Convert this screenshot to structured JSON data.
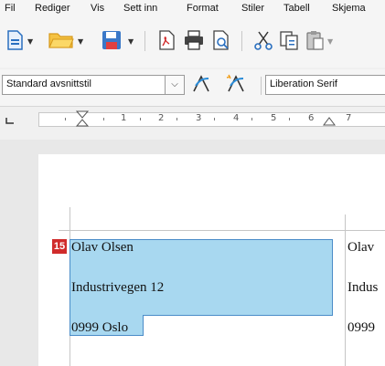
{
  "menu": [
    "Fil",
    "Rediger",
    "Vis",
    "Sett inn",
    "Format",
    "Stiler",
    "Tabell",
    "Skjema"
  ],
  "toolbar": {
    "icons": [
      "new-document-icon",
      "open-folder-icon",
      "save-icon",
      "export-pdf-icon",
      "print-icon",
      "print-preview-icon",
      "cut-icon",
      "copy-icon",
      "paste-icon"
    ]
  },
  "format": {
    "paragraph_style": "Standard avsnittstil",
    "font_name": "Liberation Serif"
  },
  "ruler": {
    "numbers": [
      "1",
      "2",
      "3",
      "4",
      "5",
      "6",
      "7"
    ]
  },
  "document": {
    "field_badge": "15",
    "label1": {
      "name": "Olav Olsen",
      "street": "Industrivegen 12",
      "city": "0999 Oslo"
    },
    "label2": {
      "name": "Olav",
      "street": "Indus",
      "city": "0999"
    }
  },
  "colors": {
    "selection": "#a8d8f0",
    "selection_border": "#4a8cc8",
    "badge": "#d02b2b"
  }
}
